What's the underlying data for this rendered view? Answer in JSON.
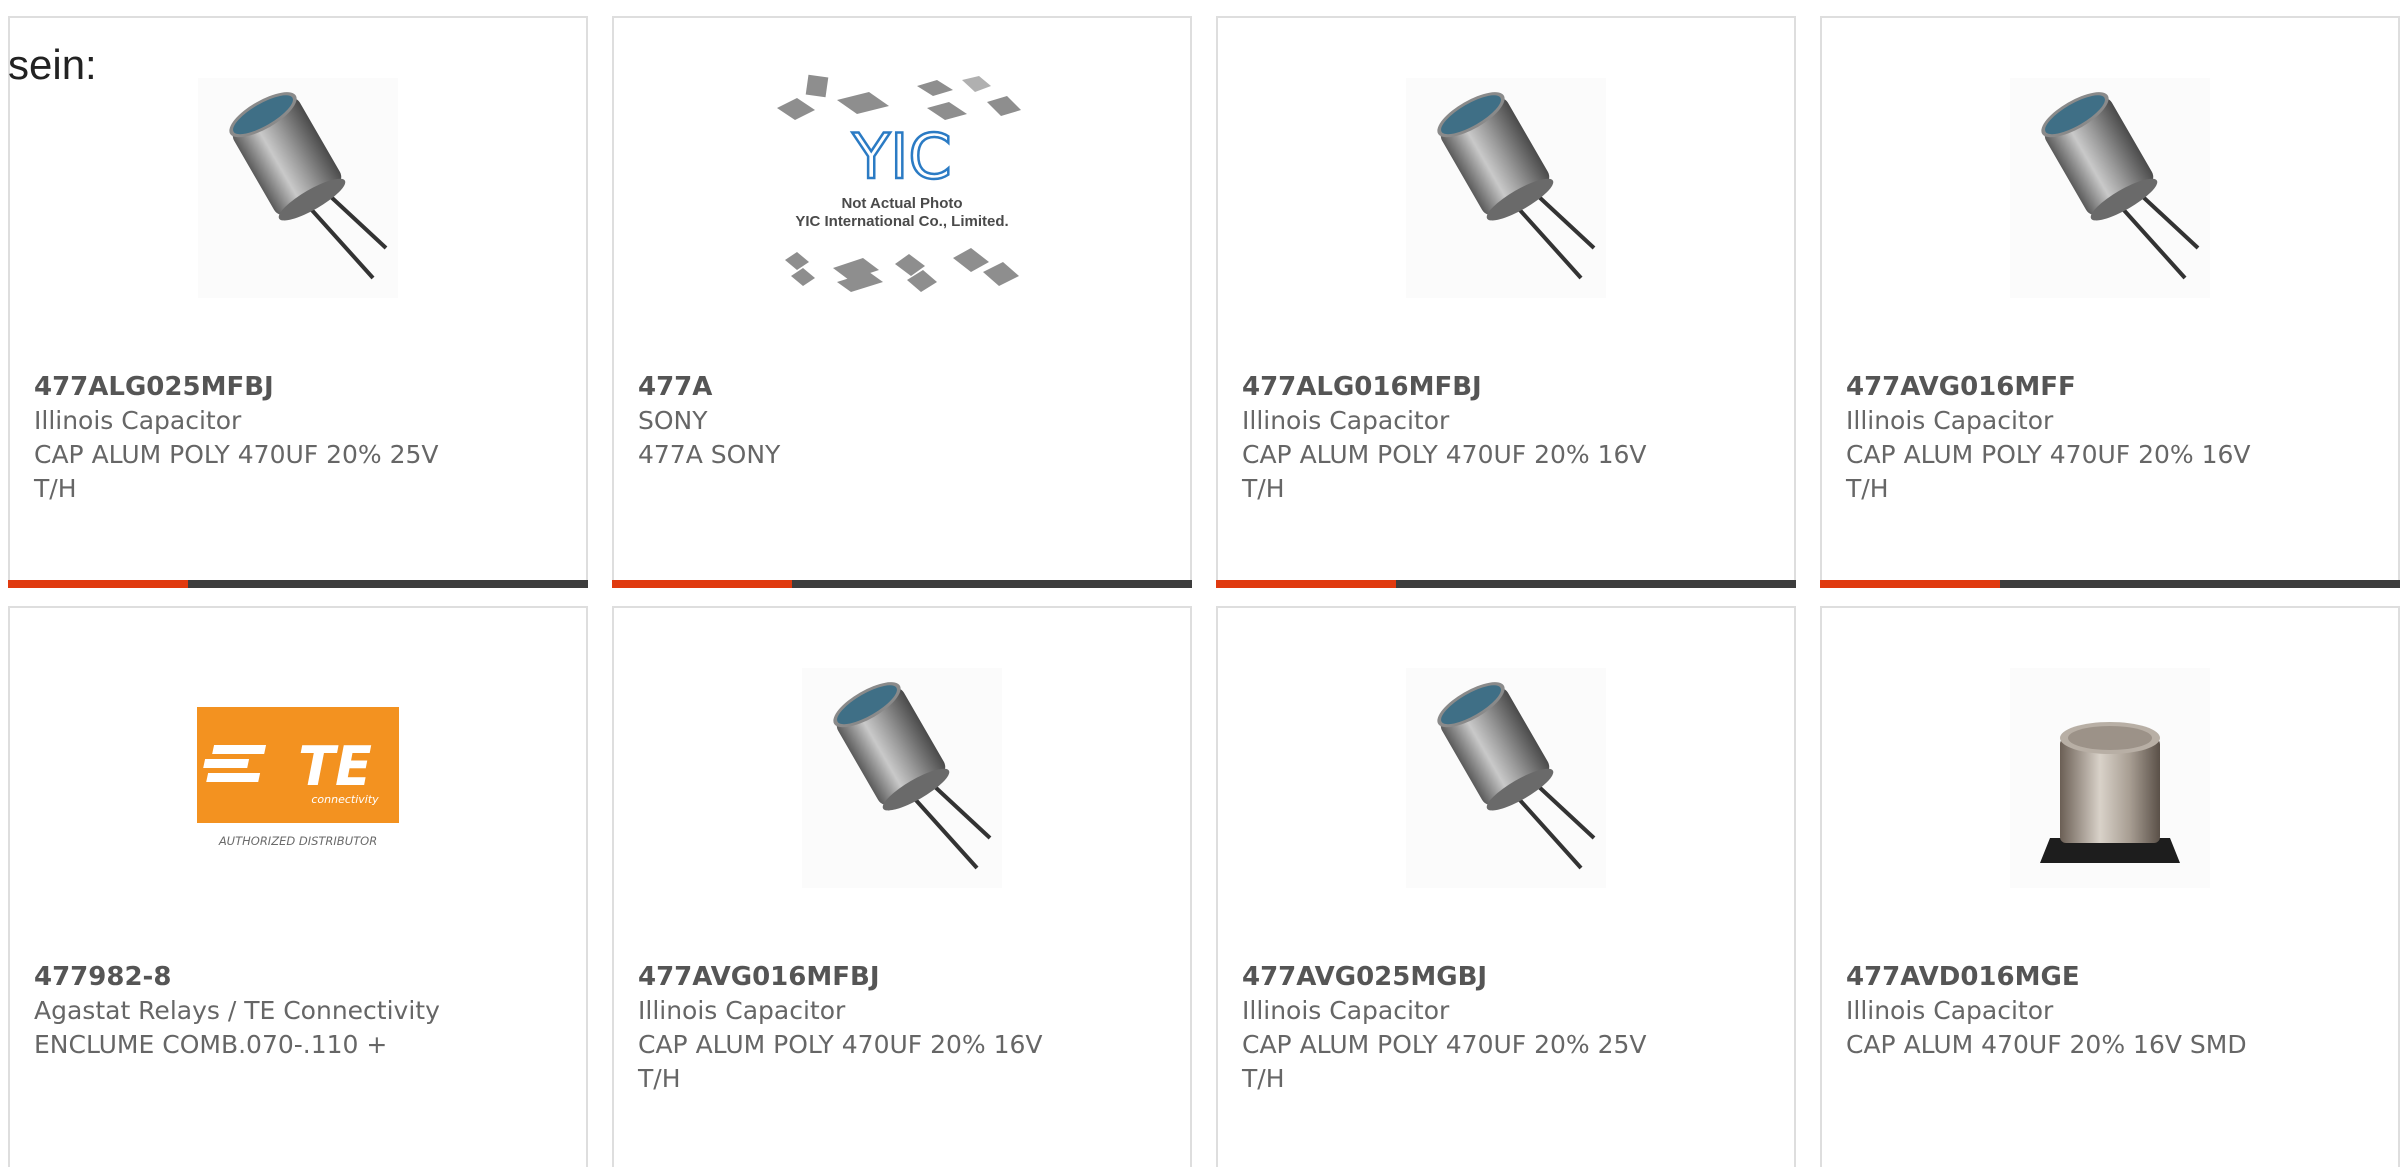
{
  "intro_text": "sein:",
  "colors": {
    "bar_accent": "#e03a0f",
    "bar_dark": "#3d3d3d",
    "te_orange": "#f39220"
  },
  "progress_fraction": 0.31,
  "products": [
    {
      "part": "477ALG025MFBJ",
      "brand": "Illinois Capacitor",
      "desc": "CAP ALUM POLY 470UF 20% 25V T/H",
      "image": "radial-capacitor-icon"
    },
    {
      "part": "477A",
      "brand": "SONY",
      "desc": "477A SONY",
      "image": "yic-placeholder-icon"
    },
    {
      "part": "477ALG016MFBJ",
      "brand": "Illinois Capacitor",
      "desc": "CAP ALUM POLY 470UF 20% 16V T/H",
      "image": "radial-capacitor-icon"
    },
    {
      "part": "477AVG016MFF",
      "brand": "Illinois Capacitor",
      "desc": "CAP ALUM POLY 470UF 20% 16V T/H",
      "image": "radial-capacitor-icon"
    },
    {
      "part": "477982-8",
      "brand": "Agastat Relays / TE Connectivity",
      "desc": "ENCLUME COMB.070-.110 +",
      "image": "te-logo-icon"
    },
    {
      "part": "477AVG016MFBJ",
      "brand": "Illinois Capacitor",
      "desc": "CAP ALUM POLY 470UF 20% 16V T/H",
      "image": "radial-capacitor-icon"
    },
    {
      "part": "477AVG025MGBJ",
      "brand": "Illinois Capacitor",
      "desc": "CAP ALUM POLY 470UF 20% 25V T/H",
      "image": "radial-capacitor-icon"
    },
    {
      "part": "477AVD016MGE",
      "brand": "Illinois Capacitor",
      "desc": "CAP ALUM 470UF 20% 16V SMD",
      "image": "smd-capacitor-icon"
    }
  ],
  "placeholder": {
    "line1": "Not Actual Photo",
    "line2": "YIC International Co., Limited.",
    "logo": "YIC"
  },
  "te_logo": {
    "mark": "TE",
    "sub": "connectivity",
    "caption": "AUTHORIZED DISTRIBUTOR"
  }
}
